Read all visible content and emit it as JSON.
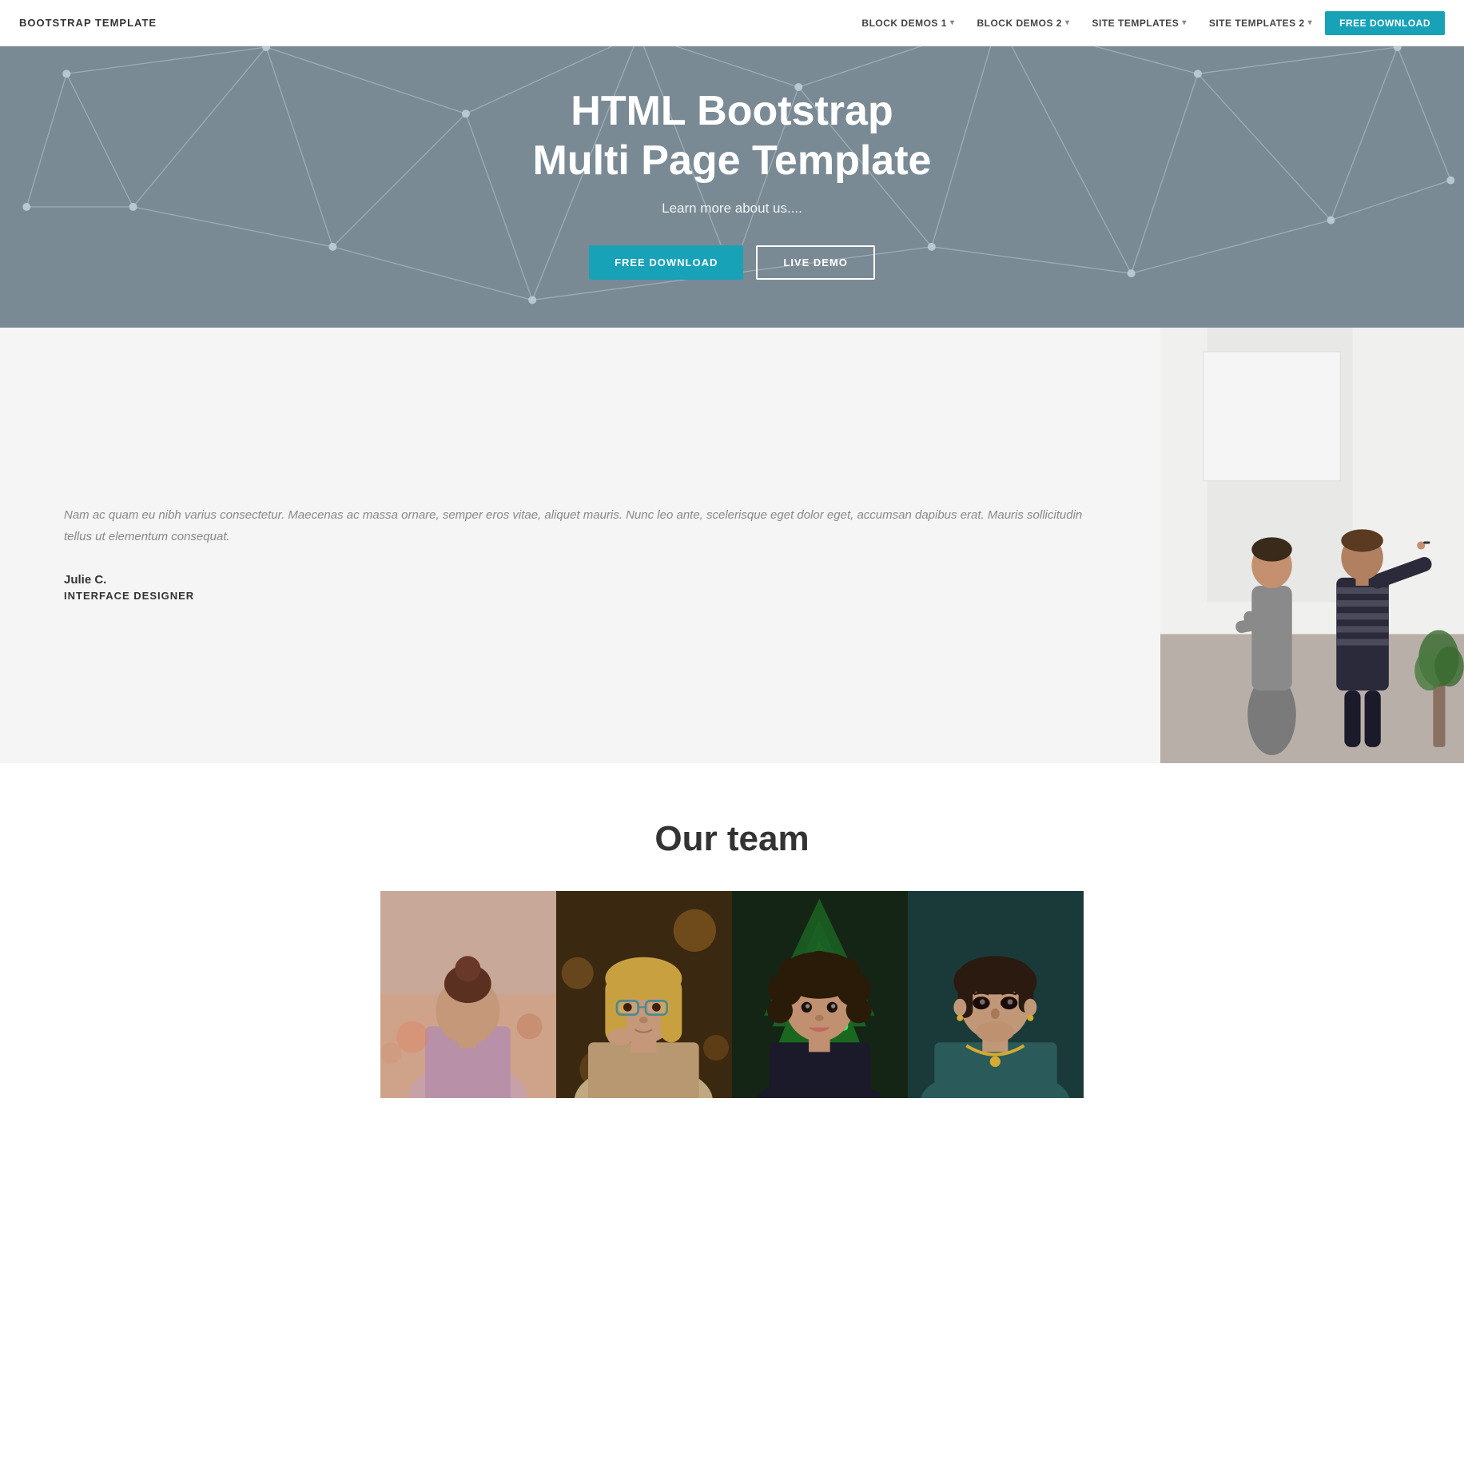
{
  "navbar": {
    "brand": "BOOTSTRAP TEMPLATE",
    "items": [
      {
        "label": "BLOCK DEMOS 1",
        "dropdown": true
      },
      {
        "label": "BLOCK DEMOS 2",
        "dropdown": true
      },
      {
        "label": "SITE TEMPLATES",
        "dropdown": true
      },
      {
        "label": "SITE TEMPLATES 2",
        "dropdown": true
      }
    ],
    "cta": "FREE DOWNLOAD"
  },
  "hero": {
    "title_line1": "HTML Bootstrap",
    "title_line2": "Multi Page Template",
    "subtitle": "Learn more about us....",
    "btn_primary": "FREE DOWNLOAD",
    "btn_secondary": "LIVE DEMO"
  },
  "about": {
    "quote": "Nam ac quam eu nibh varius consectetur. Maecenas ac massa ornare, semper eros vitae, aliquet mauris. Nunc leo ante, scelerisque eget dolor eget, accumsan dapibus erat. Mauris sollicitudin tellus ut elementum consequat.",
    "name": "Julie C.",
    "role": "INTERFACE DESIGNER"
  },
  "team": {
    "title": "Our team",
    "members": [
      {
        "id": 1,
        "bg": "#8a7080"
      },
      {
        "id": 2,
        "bg": "#6b5a3e"
      },
      {
        "id": 3,
        "bg": "#3a4a35"
      },
      {
        "id": 4,
        "bg": "#4a5a5f"
      }
    ]
  },
  "colors": {
    "accent": "#17a2b8",
    "hero_bg": "#7a8a95",
    "section_bg": "#f5f5f5"
  }
}
